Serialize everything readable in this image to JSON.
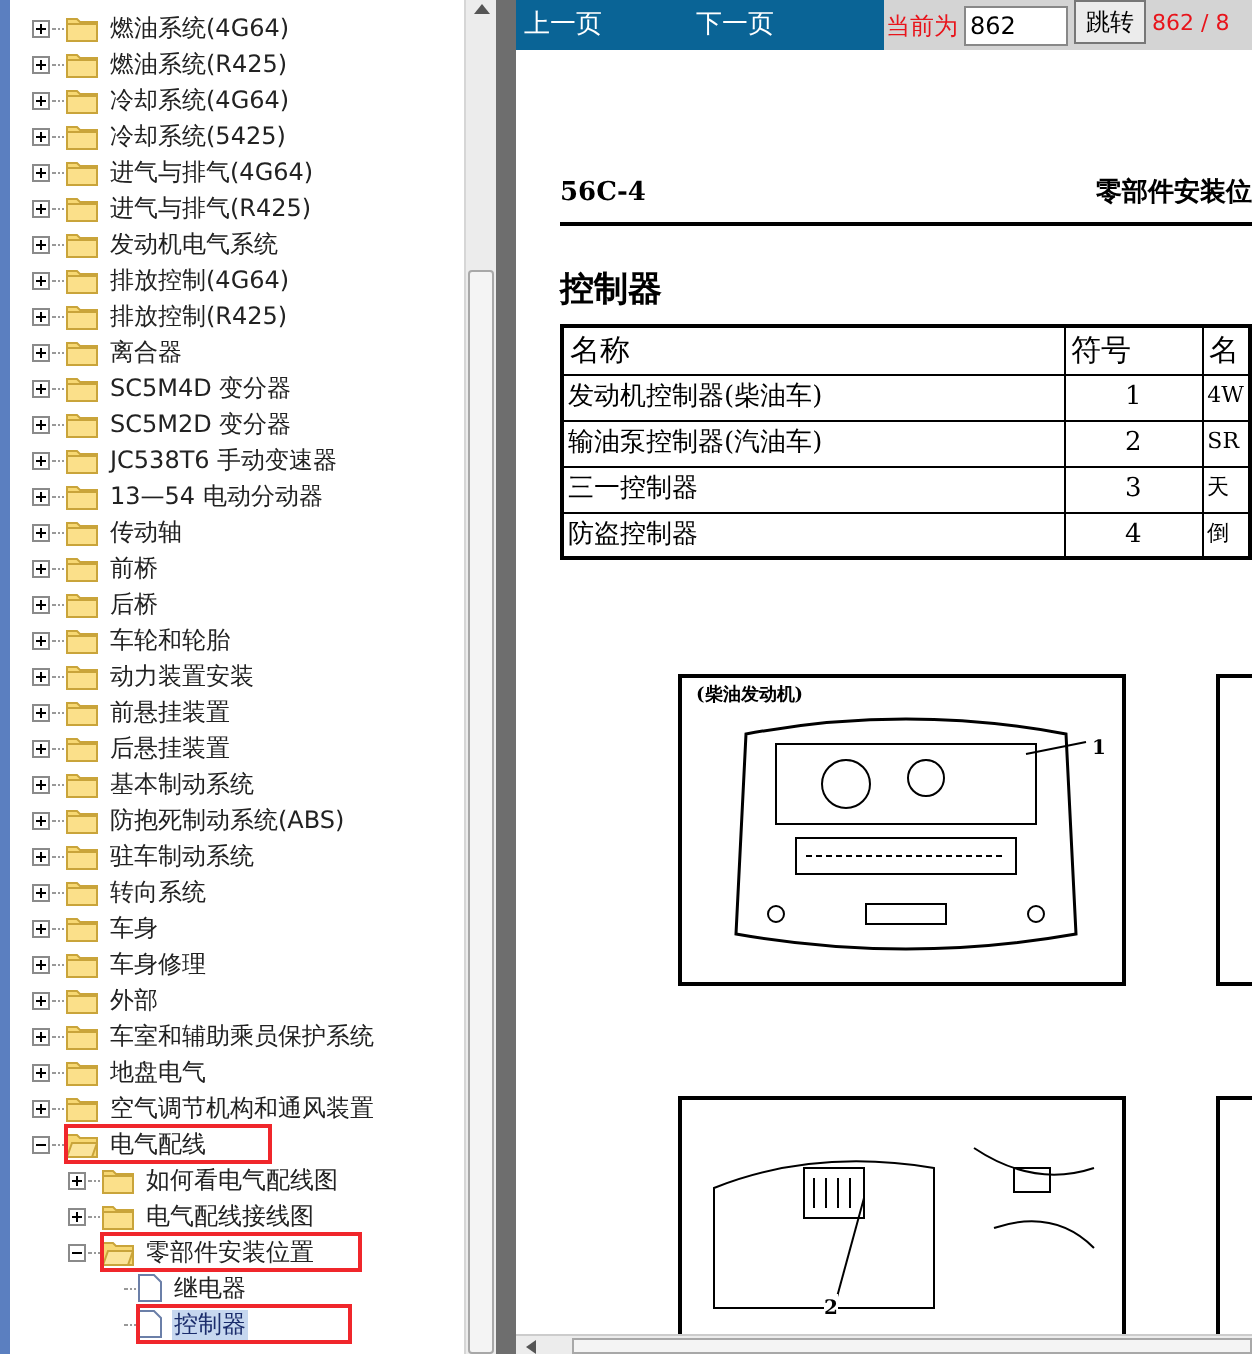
{
  "tree": {
    "items": [
      {
        "label": "燃油系统(4G64)",
        "kind": "folder",
        "expanded": false,
        "selected": false,
        "marked": false
      },
      {
        "label": "燃油系统(R425)",
        "kind": "folder",
        "expanded": false,
        "selected": false,
        "marked": false
      },
      {
        "label": "冷却系统(4G64)",
        "kind": "folder",
        "expanded": false,
        "selected": false,
        "marked": false
      },
      {
        "label": "冷却系统(5425)",
        "kind": "folder",
        "expanded": false,
        "selected": false,
        "marked": false
      },
      {
        "label": "进气与排气(4G64)",
        "kind": "folder",
        "expanded": false,
        "selected": false,
        "marked": false
      },
      {
        "label": "进气与排气(R425)",
        "kind": "folder",
        "expanded": false,
        "selected": false,
        "marked": false
      },
      {
        "label": "发动机电气系统",
        "kind": "folder",
        "expanded": false,
        "selected": false,
        "marked": false
      },
      {
        "label": "排放控制(4G64)",
        "kind": "folder",
        "expanded": false,
        "selected": false,
        "marked": false
      },
      {
        "label": "排放控制(R425)",
        "kind": "folder",
        "expanded": false,
        "selected": false,
        "marked": false
      },
      {
        "label": "离合器",
        "kind": "folder",
        "expanded": false,
        "selected": false,
        "marked": false
      },
      {
        "label": "SC5M4D 变分器",
        "kind": "folder",
        "expanded": false,
        "selected": false,
        "marked": false
      },
      {
        "label": "SC5M2D 变分器",
        "kind": "folder",
        "expanded": false,
        "selected": false,
        "marked": false
      },
      {
        "label": "JC538T6 手动变速器",
        "kind": "folder",
        "expanded": false,
        "selected": false,
        "marked": false
      },
      {
        "label": "13—54 电动分动器",
        "kind": "folder",
        "expanded": false,
        "selected": false,
        "marked": false
      },
      {
        "label": "传动轴",
        "kind": "folder",
        "expanded": false,
        "selected": false,
        "marked": false
      },
      {
        "label": "前桥",
        "kind": "folder",
        "expanded": false,
        "selected": false,
        "marked": false
      },
      {
        "label": "后桥",
        "kind": "folder",
        "expanded": false,
        "selected": false,
        "marked": false
      },
      {
        "label": "车轮和轮胎",
        "kind": "folder",
        "expanded": false,
        "selected": false,
        "marked": false
      },
      {
        "label": "动力装置安装",
        "kind": "folder",
        "expanded": false,
        "selected": false,
        "marked": false
      },
      {
        "label": "前悬挂装置",
        "kind": "folder",
        "expanded": false,
        "selected": false,
        "marked": false
      },
      {
        "label": "后悬挂装置",
        "kind": "folder",
        "expanded": false,
        "selected": false,
        "marked": false
      },
      {
        "label": "基本制动系统",
        "kind": "folder",
        "expanded": false,
        "selected": false,
        "marked": false
      },
      {
        "label": "防抱死制动系统(ABS)",
        "kind": "folder",
        "expanded": false,
        "selected": false,
        "marked": false
      },
      {
        "label": "驻车制动系统",
        "kind": "folder",
        "expanded": false,
        "selected": false,
        "marked": false
      },
      {
        "label": "转向系统",
        "kind": "folder",
        "expanded": false,
        "selected": false,
        "marked": false
      },
      {
        "label": "车身",
        "kind": "folder",
        "expanded": false,
        "selected": false,
        "marked": false
      },
      {
        "label": "车身修理",
        "kind": "folder",
        "expanded": false,
        "selected": false,
        "marked": false
      },
      {
        "label": "外部",
        "kind": "folder",
        "expanded": false,
        "selected": false,
        "marked": false
      },
      {
        "label": "车室和辅助乘员保护系统",
        "kind": "folder",
        "expanded": false,
        "selected": false,
        "marked": false
      },
      {
        "label": "地盘电气",
        "kind": "folder",
        "expanded": false,
        "selected": false,
        "marked": false
      },
      {
        "label": "空气调节机构和通风装置",
        "kind": "folder",
        "expanded": false,
        "selected": false,
        "marked": false
      },
      {
        "label": "电气配线",
        "kind": "folder",
        "expanded": true,
        "selected": false,
        "marked": true,
        "children": [
          {
            "label": "如何看电气配线图",
            "kind": "folder",
            "expanded": false,
            "selected": false,
            "marked": false
          },
          {
            "label": "电气配线接线图",
            "kind": "folder",
            "expanded": false,
            "selected": false,
            "marked": false
          },
          {
            "label": "零部件安装位置",
            "kind": "folder",
            "expanded": true,
            "selected": false,
            "marked": true,
            "children": [
              {
                "label": "继电器",
                "kind": "document",
                "selected": false,
                "marked": false
              },
              {
                "label": "控制器",
                "kind": "document",
                "selected": true,
                "marked": true
              }
            ]
          }
        ]
      }
    ]
  },
  "toolbar": {
    "prev": "上一页",
    "next": "下一页",
    "current_label": "当前为",
    "page_value": "862",
    "jump_button": "跳转",
    "page_count": "862 / 8"
  },
  "document": {
    "page_code": "56C-4",
    "header_title": "零部件安装位",
    "section_title": "控制器",
    "table": {
      "columns": [
        "名称",
        "符号",
        "名"
      ],
      "rows": [
        [
          "发动机控制器(柴油车)",
          "1",
          "4W"
        ],
        [
          "输油泵控制器(汽油车)",
          "2",
          "SR"
        ],
        [
          "三一控制器",
          "3",
          "天"
        ],
        [
          "防盗控制器",
          "4",
          "倒"
        ]
      ]
    },
    "figures": [
      {
        "kind": "engine",
        "caption": "(柴油发动机)",
        "callout": "1"
      },
      {
        "kind": "dashboard",
        "callout": "2"
      }
    ]
  }
}
